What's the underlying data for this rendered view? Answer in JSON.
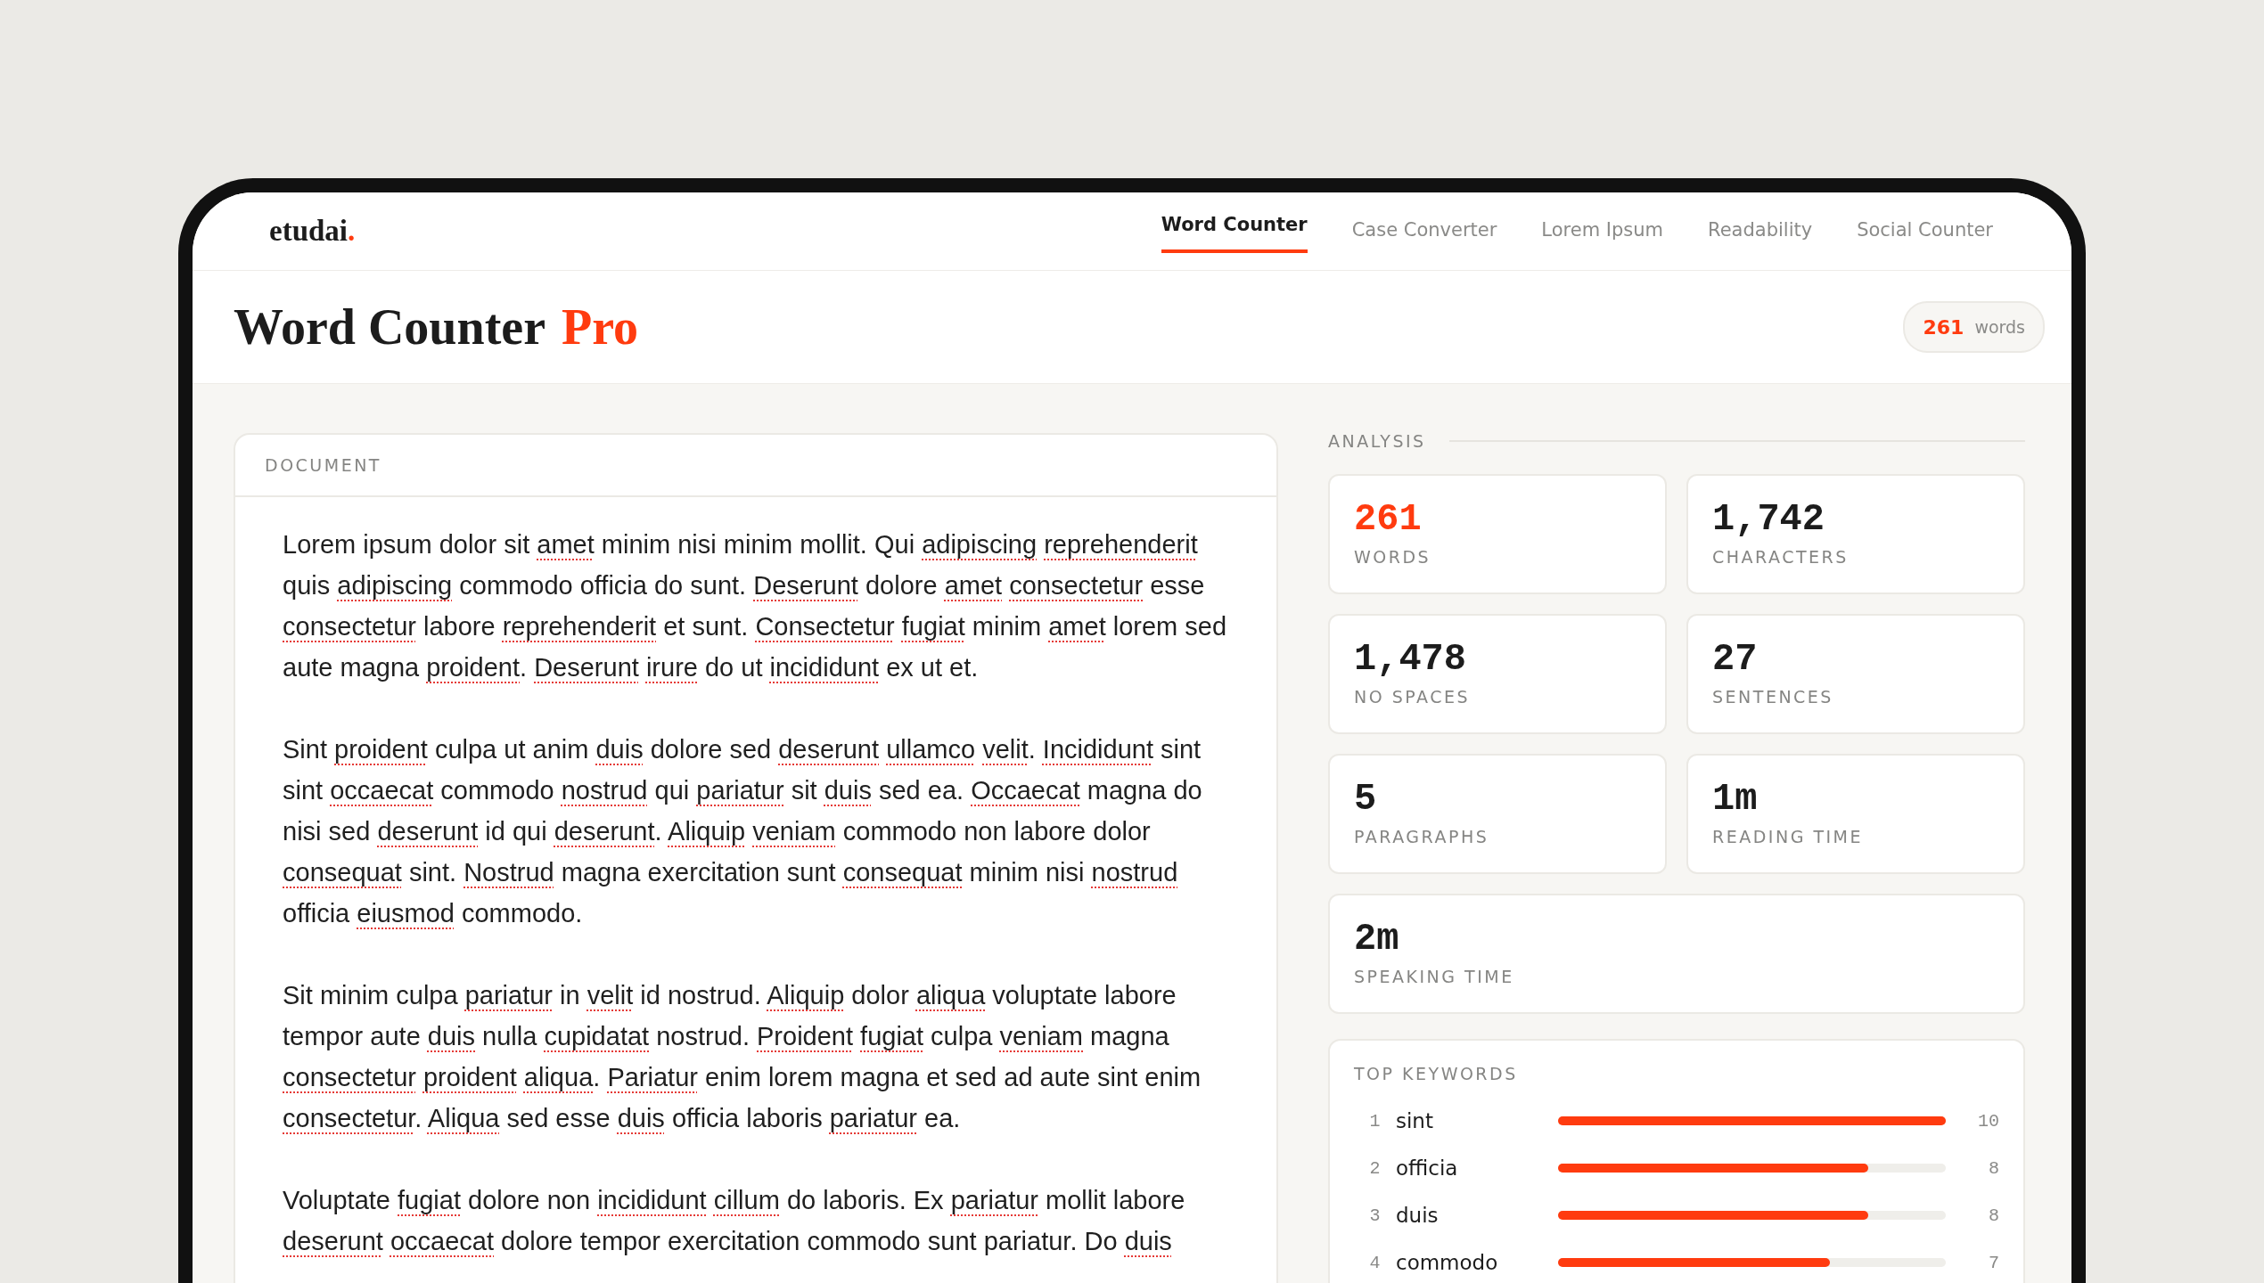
{
  "logo": {
    "name": "etudai",
    "dot": "."
  },
  "nav": [
    {
      "label": "Word Counter",
      "selected": true
    },
    {
      "label": "Case Converter",
      "selected": false
    },
    {
      "label": "Lorem Ipsum",
      "selected": false
    },
    {
      "label": "Readability",
      "selected": false
    },
    {
      "label": "Social Counter",
      "selected": false
    }
  ],
  "title": {
    "main": "Word Counter",
    "accent": "Pro"
  },
  "badge": {
    "count": "261",
    "unit": "words"
  },
  "document": {
    "heading": "DOCUMENT",
    "paragraphs": [
      "Lorem ipsum dolor sit *amet* minim nisi minim mollit. Qui *adipiscing* *reprehenderit* quis *adipiscing* commodo officia do sunt. *Deserunt* dolore *amet* *consectetur* esse *consectetur* labore *reprehenderit* et sunt. *Consectetur* *fugiat* minim *amet* lorem sed aute magna *proident*. *Deserunt* *irure* do ut *incididunt* ex ut et.",
      "Sint *proident* culpa ut anim *duis* dolore sed *deserunt* *ullamco* *velit*. *Incididunt* sint sint *occaecat* commodo *nostrud* qui *pariatur* sit *duis* sed ea. *Occaecat* magna do nisi sed *deserunt* id qui *deserunt*. *Aliquip* *veniam* commodo non labore dolor *consequat* sint. *Nostrud* magna exercitation sunt *consequat* minim nisi *nostrud* officia *eiusmod* commodo.",
      "Sit minim culpa *pariatur* in *velit* id nostrud. *Aliquip* dolor *aliqua* voluptate labore tempor aute *duis* nulla *cupidatat* nostrud. *Proident* *fugiat* culpa *veniam* magna *consectetur* *proident* *aliqua*. *Pariatur* enim lorem magna et sed ad aute sint enim *consectetur*. *Aliqua* sed esse *duis* officia laboris *pariatur* ea.",
      "Voluptate *fugiat* dolore non *incididunt* *cillum* do laboris. Ex *pariatur* mollit labore *deserunt* *occaecat* dolore tempor exercitation commodo sunt pariatur. Do *duis*"
    ]
  },
  "analysis": {
    "heading": "ANALYSIS",
    "stats": [
      {
        "value": "261",
        "label": "WORDS",
        "accent": true,
        "wide": false
      },
      {
        "value": "1,742",
        "label": "CHARACTERS",
        "accent": false,
        "wide": false
      },
      {
        "value": "1,478",
        "label": "NO SPACES",
        "accent": false,
        "wide": false
      },
      {
        "value": "27",
        "label": "SENTENCES",
        "accent": false,
        "wide": false
      },
      {
        "value": "5",
        "label": "PARAGRAPHS",
        "accent": false,
        "wide": false
      },
      {
        "value": "1m",
        "label": "READING TIME",
        "accent": false,
        "wide": false
      },
      {
        "value": "2m",
        "label": "SPEAKING TIME",
        "accent": false,
        "wide": true
      }
    ],
    "keywords": {
      "heading": "TOP KEYWORDS",
      "items": [
        {
          "rank": "1",
          "word": "sint",
          "level": 1.0,
          "count": "10"
        },
        {
          "rank": "2",
          "word": "officia",
          "level": 0.8,
          "count": "8"
        },
        {
          "rank": "3",
          "word": "duis",
          "level": 0.8,
          "count": "8"
        },
        {
          "rank": "4",
          "word": "commodo",
          "level": 0.7,
          "count": "7"
        }
      ]
    }
  }
}
